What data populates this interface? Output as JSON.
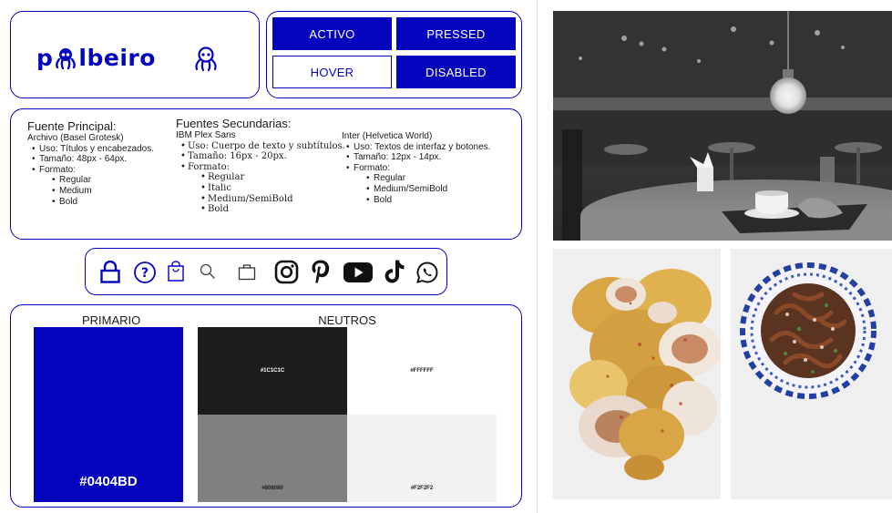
{
  "brand": {
    "logo_part_a": "p",
    "logo_part_b": "lbeiro",
    "primary_color": "#0404BD"
  },
  "states": {
    "activo": "ACTIVO",
    "pressed": "PRESSED",
    "hover": "HOVER",
    "disabled": "DISABLED"
  },
  "fonts": {
    "principal": {
      "heading": "Fuente Principal:",
      "name": "Archivo (Basel Grotesk)",
      "items": [
        "Uso: Títulos y encabezados.",
        "Tamaño: 48px - 64px.",
        "Formato:"
      ],
      "formats": [
        "Regular",
        "Medium",
        "Bold"
      ]
    },
    "ibm": {
      "heading": "Fuentes Secundarias:",
      "name": "IBM Plex Sans",
      "items": [
        "Uso: Cuerpo de texto y subtítulos.",
        "Tamaño: 16px - 20px.",
        "Formato:"
      ],
      "formats": [
        "Regular",
        "Italic",
        "Medium/SemiBold",
        "Bold"
      ]
    },
    "inter": {
      "name": "Inter (Helvetica World)",
      "items": [
        "Uso: Textos de interfaz y botones.",
        "Tamaño: 12px - 14px.",
        "Formato:"
      ],
      "formats": [
        "Regular",
        "Medium/SemiBold",
        "Bold"
      ]
    }
  },
  "icons": [
    "lock-icon",
    "help-icon",
    "shopping-bag-icon",
    "search-icon",
    "bag-icon",
    "instagram-icon",
    "pinterest-icon",
    "youtube-icon",
    "tiktok-icon",
    "whatsapp-icon"
  ],
  "colors": {
    "primario_title": "PRIMARIO",
    "neutros_title": "NEUTROS",
    "primario": "#0404BD",
    "neutral_1": "#1C1C1C",
    "neutral_2": "#FFFFFF",
    "neutral_3": "#808080",
    "neutral_4": "#F2F2F2"
  }
}
